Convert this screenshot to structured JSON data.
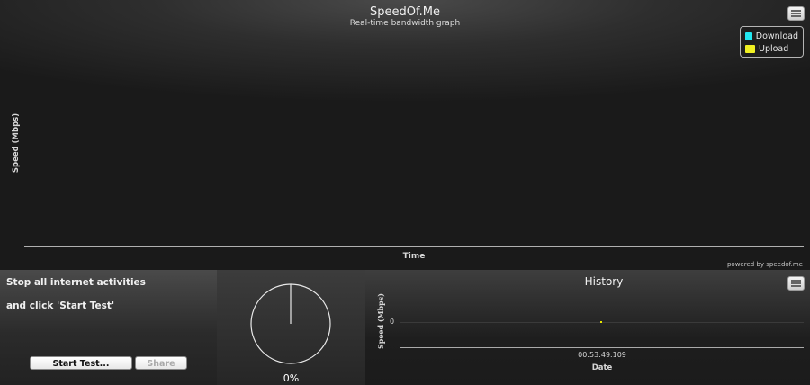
{
  "graph": {
    "title": "SpeedOf.Me",
    "subtitle": "Real-time bandwidth graph",
    "ylabel": "Speed (Mbps)",
    "xlabel": "Time",
    "powered_by": "powered by speedof.me",
    "legend": [
      {
        "label": "Download",
        "color": "#22e6f0"
      },
      {
        "label": "Upload",
        "color": "#f0f022"
      }
    ],
    "menu_icon": "hamburger-icon"
  },
  "instructions": {
    "line1": "Stop all internet activities",
    "line2": "and click 'Start Test'",
    "start_label": "Start Test...",
    "share_label": "Share"
  },
  "progress": {
    "percent_label": "0%",
    "value": 0
  },
  "history": {
    "title": "History",
    "ylabel": "Speed (Mbps)",
    "y_tick": "0",
    "x_tick": "00:53:49.109",
    "xlabel": "Date",
    "menu_icon": "hamburger-icon",
    "point_color": "#e6e600"
  }
}
